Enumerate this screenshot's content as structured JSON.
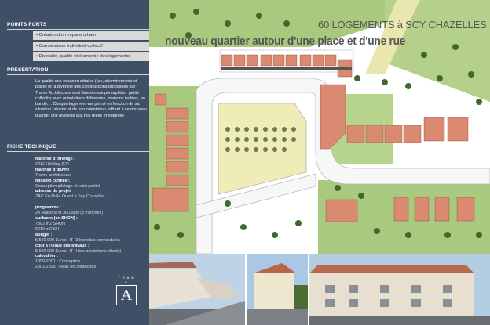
{
  "sidebar": {
    "points_forts": {
      "title": "POINTS FORTS",
      "items": [
        "• Création d'un espace urbain",
        "• Combinaison Individuel-collectif",
        "• Diversité, qualité et économie des logements"
      ]
    },
    "presentation": {
      "title": "PRESENTATION",
      "text": "La qualité des espaces urbains (rue, cheminements et place) et la diversité des constructions proposées par Trame Architecture sont directement perceptible : petits collectifs avec orientations différentes, maisons isolées, en bande,... Chaque logement est pensé en fonction de sa situation urbaine et de son orientation, offrant à ce nouveau quartier une diversité à la fois réelle et naturelle"
    },
    "fiche_technique": {
      "title": "FICHE TECHNIQUE",
      "lines": [
        {
          "label": "maitrise d'ouvrage :",
          "value": "GNC Holding (57)"
        },
        {
          "label": "maitrise d'œuvre :",
          "value": "Trame architecture"
        },
        {
          "label": "mission confiée :",
          "value": "Conception pilotage et suivi partiel"
        },
        {
          "label": "adresse du projet",
          "value": "ZAC En Prille Ouest à Scy Chazelles"
        },
        {
          "label": "",
          "value": ""
        },
        {
          "label": "programme :",
          "value": "24 Maisons et 36 Logts (3 tranches)"
        },
        {
          "label": "surfaces (en SHON) :",
          "value": "7302 m2 SHON\n6210 m2 SH"
        },
        {
          "label": "budget :",
          "value": "5 560 000 Euros HT (3 tranches confondues)"
        },
        {
          "label": "coût à l'issue des travaux :",
          "value": "5 600 000 Euros HT (Hors prestations clients)"
        },
        {
          "label": "calendrier :",
          "value": "1999-2001 : Conception\n2001-2006 : Réal. en 3 tranches"
        }
      ]
    },
    "logo": {
      "top": "T R A M E",
      "letter": "A"
    }
  },
  "header": {
    "title": "60 LOGEMENTS à SCY CHAZELLES",
    "subtitle": "nouveau quartier autour d'une place et d'une rue"
  },
  "colors": {
    "sidebar": "#3f4f66",
    "grass": "#9bbf70",
    "roof": "#d98a70",
    "plaza": "#f0ecb8",
    "road": "#f4f4f4"
  }
}
